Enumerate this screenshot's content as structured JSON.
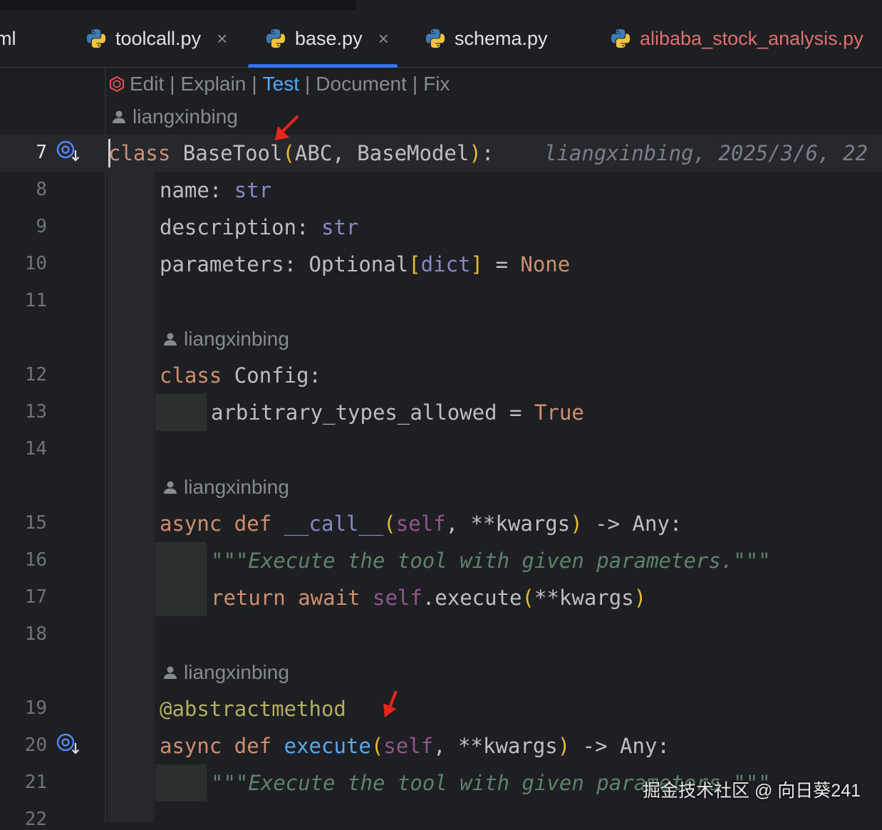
{
  "tabs": [
    {
      "label": "toolcall.py",
      "has_close": true,
      "active": false,
      "modified": false
    },
    {
      "label": "base.py",
      "has_close": true,
      "active": true,
      "modified": false
    },
    {
      "label": "schema.py",
      "has_close": false,
      "active": false,
      "modified": false
    },
    {
      "label": "alibaba_stock_analysis.py",
      "has_close": false,
      "active": false,
      "modified": true
    }
  ],
  "partial_tab": "ml",
  "close_glyph": "×",
  "ai_actions": [
    "Edit",
    "Explain",
    "Test",
    "Document",
    "Fix"
  ],
  "ai_active": "Test",
  "author": "liangxinbing",
  "blame": "liangxinbing, 2025/3/6, 22",
  "line_numbers": [
    "7",
    "8",
    "9",
    "10",
    "11",
    "12",
    "13",
    "14",
    "15",
    "16",
    "17",
    "18",
    "19",
    "20",
    "21",
    "22"
  ],
  "code": {
    "l7_kw": "class",
    "l7_name": " BaseTool",
    "l7_p1": "(",
    "l7_args": "ABC, BaseModel",
    "l7_p2": ")",
    "l7_colon": ":",
    "l8_a": "name: ",
    "l8_b": "str",
    "l9_a": "description: ",
    "l9_b": "str",
    "l10_a": "parameters: Optional",
    "l10_b": "[",
    "l10_c": "dict",
    "l10_d": "]",
    "l10_e": " = ",
    "l10_f": "None",
    "l12_kw": "class",
    "l12_name": " Config:",
    "l13_a": "arbitrary_types_allowed = ",
    "l13_b": "True",
    "l15_kw": "async def ",
    "l15_fn": "__call__",
    "l15_p1": "(",
    "l15_self": "self",
    "l15_rest": ", **kwargs",
    "l15_p2": ")",
    "l15_ret": " -> Any:",
    "l16_doc": "\"\"\"Execute the tool with given parameters.\"\"\"",
    "l17_kw": "return await ",
    "l17_self": "self",
    "l17_call": ".execute",
    "l17_p1": "(",
    "l17_args": "**kwargs",
    "l17_p2": ")",
    "l19_dec": "@abstractmethod",
    "l20_kw": "async def ",
    "l20_fn": "execute",
    "l20_p1": "(",
    "l20_self": "self",
    "l20_rest": ", **kwargs",
    "l20_p2": ")",
    "l20_ret": " -> Any:",
    "l21_doc": "\"\"\"Execute the tool with given parameters.\"\"\""
  },
  "watermark": "掘金技术社区 @ 向日葵241",
  "colors": {
    "background": "#1e1f22",
    "keyword": "#cf8e6d",
    "function": "#56a8f5",
    "builtin": "#8888c6",
    "decorator": "#b3ae60",
    "docstring": "#5f826b",
    "accent": "#3574f0",
    "arrow": "#e8261b"
  }
}
